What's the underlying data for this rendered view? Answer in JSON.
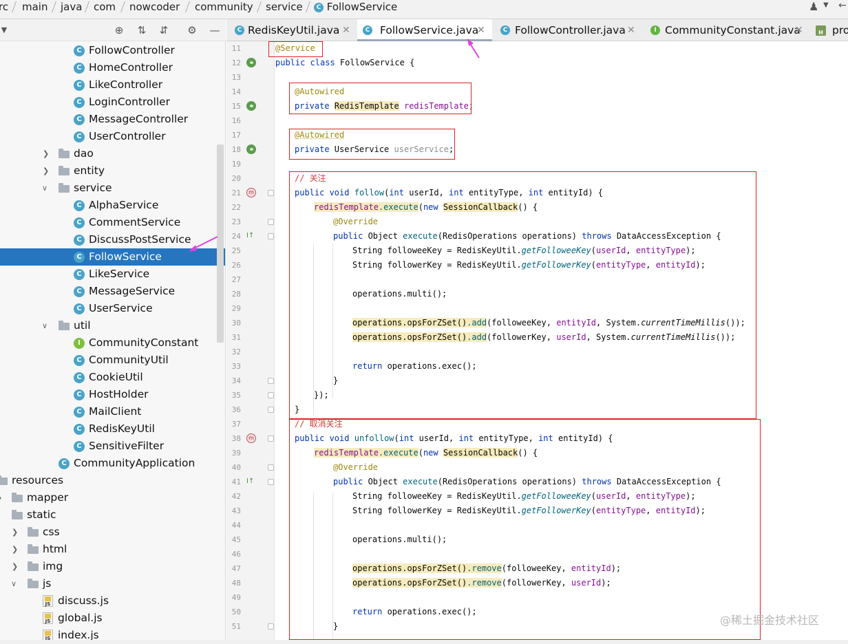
{
  "breadcrumb": {
    "items": [
      "rc",
      "main",
      "java",
      "com",
      "nowcoder",
      "community",
      "service",
      "FollowService"
    ],
    "active_icon": "class-icon"
  },
  "project_tree": {
    "nodes": [
      {
        "label": "FollowController",
        "icon": "class-icon",
        "kind": "class"
      },
      {
        "label": "HomeController",
        "icon": "class-icon",
        "kind": "class"
      },
      {
        "label": "LikeController",
        "icon": "class-icon",
        "kind": "class"
      },
      {
        "label": "LoginController",
        "icon": "class-icon",
        "kind": "class"
      },
      {
        "label": "MessageController",
        "icon": "class-icon",
        "kind": "class"
      },
      {
        "label": "UserController",
        "icon": "class-icon",
        "kind": "class"
      },
      {
        "label": "dao",
        "icon": "folder-icon",
        "kind": "folder",
        "expanded": false
      },
      {
        "label": "entity",
        "icon": "folder-icon",
        "kind": "folder",
        "expanded": false
      },
      {
        "label": "service",
        "icon": "folder-icon",
        "kind": "folder",
        "expanded": true
      },
      {
        "label": "AlphaService",
        "icon": "class-icon",
        "kind": "class"
      },
      {
        "label": "CommentService",
        "icon": "class-icon",
        "kind": "class"
      },
      {
        "label": "DiscussPostService",
        "icon": "class-icon",
        "kind": "class"
      },
      {
        "label": "FollowService",
        "icon": "class-icon",
        "kind": "class",
        "selected": true
      },
      {
        "label": "LikeService",
        "icon": "class-icon",
        "kind": "class"
      },
      {
        "label": "MessageService",
        "icon": "class-icon",
        "kind": "class"
      },
      {
        "label": "UserService",
        "icon": "class-icon",
        "kind": "class"
      },
      {
        "label": "util",
        "icon": "folder-icon",
        "kind": "folder",
        "expanded": true
      },
      {
        "label": "CommunityConstant",
        "icon": "interface-icon",
        "kind": "interface"
      },
      {
        "label": "CommunityUtil",
        "icon": "class-icon",
        "kind": "class"
      },
      {
        "label": "CookieUtil",
        "icon": "class-icon",
        "kind": "class"
      },
      {
        "label": "HostHolder",
        "icon": "class-icon",
        "kind": "class"
      },
      {
        "label": "MailClient",
        "icon": "class-icon",
        "kind": "class"
      },
      {
        "label": "RedisKeyUtil",
        "icon": "class-icon",
        "kind": "class"
      },
      {
        "label": "SensitiveFilter",
        "icon": "class-icon",
        "kind": "class"
      },
      {
        "label": "CommunityApplication",
        "icon": "spring-app-icon",
        "kind": "app"
      },
      {
        "label": "resources",
        "icon": "folder-icon",
        "kind": "folder"
      },
      {
        "label": "mapper",
        "icon": "folder-icon",
        "kind": "folder"
      },
      {
        "label": "static",
        "icon": "folder-icon",
        "kind": "folder",
        "expanded": true
      },
      {
        "label": "css",
        "icon": "folder-icon",
        "kind": "folder"
      },
      {
        "label": "html",
        "icon": "folder-icon",
        "kind": "folder"
      },
      {
        "label": "img",
        "icon": "folder-icon",
        "kind": "folder"
      },
      {
        "label": "js",
        "icon": "folder-icon",
        "kind": "folder",
        "expanded": true
      },
      {
        "label": "discuss.js",
        "icon": "js-file-icon",
        "kind": "js"
      },
      {
        "label": "global.js",
        "icon": "js-file-icon",
        "kind": "js"
      },
      {
        "label": "index.js",
        "icon": "js-file-icon",
        "kind": "js"
      }
    ]
  },
  "tabs": [
    {
      "label": "RedisKeyUtil.java",
      "icon": "class-icon",
      "active": false
    },
    {
      "label": "FollowService.java",
      "icon": "class-icon",
      "active": true
    },
    {
      "label": "FollowController.java",
      "icon": "class-icon",
      "active": false
    },
    {
      "label": "CommunityConstant.java",
      "icon": "interface-icon",
      "active": false
    },
    {
      "label": "pro",
      "icon": "properties-icon",
      "active": false
    }
  ],
  "line_numbers": [
    "11",
    "12",
    "13",
    "14",
    "15",
    "16",
    "17",
    "18",
    "19",
    "20",
    "21",
    "22",
    "23",
    "24",
    "25",
    "26",
    "27",
    "28",
    "29",
    "30",
    "31",
    "32",
    "33",
    "34",
    "35",
    "36",
    "37",
    "38",
    "39",
    "40",
    "41",
    "42",
    "43",
    "44",
    "45",
    "46",
    "47",
    "48",
    "49",
    "50",
    "51"
  ],
  "code": {
    "l11": "@Service",
    "l12_kw": "public class",
    "l12_rest": " FollowService {",
    "l14": "@Autowired",
    "l15_kw": "private",
    "l15_type": "RedisTemplate",
    "l15_field": "redisTemplate",
    "l17": "@Autowired",
    "l18_kw": "private",
    "l18_type": " UserService ",
    "l18_field": "userService",
    "comment_follow": "// 关注",
    "follow_sig_kw1": "public void",
    "follow_name": "follow",
    "follow_params": "(int userId, int entityType, int entityId) {",
    "l22_field": "redisTemplate",
    "l22_exec": ".execute",
    "l22_new": "new",
    "l22_cb": "SessionCallback",
    "l22_end": "() {",
    "override": "@Override",
    "exec_sig_kw": "public",
    "exec_sig_obj": " Object ",
    "exec_name": "execute",
    "exec_params": "(RedisOperations operations) ",
    "exec_throws": "throws",
    "exec_exc": " DataAccessException {",
    "followee_decl": "String followeeKey = RedisKeyUtil.",
    "followee_fn": "getFolloweeKey",
    "followee_args1": "userId",
    "followee_args2": "entityType",
    "follower_decl": "String followerKey = RedisKeyUtil.",
    "follower_fn": "getFollowerKey",
    "follower_args1": "entityType",
    "follower_args2": "entityId",
    "multi": "operations.multi();",
    "zset_call": "operations.opsForZSet()",
    "add": ".add",
    "add1_args": "(followeeKey, ",
    "add1_f": "entityId",
    "add1_sys": ", System.",
    "ctm": "currentTimeMillis",
    "add1_end": "());",
    "add2_args": "(followerKey, ",
    "add2_f": "userId",
    "return_kw": "return",
    "return_rest": " operations.exec();",
    "close_brace": "}",
    "close_anon": "});",
    "comment_unfollow": "// 取消关注",
    "unfollow_name": "unfollow",
    "remove": ".remove",
    "rm1_args": "(followeeKey, ",
    "rm1_f": "entityId",
    "rm1_end": ");",
    "rm2_args": "(followerKey, ",
    "rm2_f": "userId"
  },
  "watermark": "@稀土掘金技术社区",
  "colors": {
    "annotation": "#9e880d",
    "keyword": "#0033b3",
    "field": "#871094",
    "method": "#00627a",
    "comment": "#d23c3c",
    "highlight": "#f6ebbc",
    "selection": "#2675bf",
    "red_box": "#e02020",
    "arrow": "#e040e0"
  }
}
